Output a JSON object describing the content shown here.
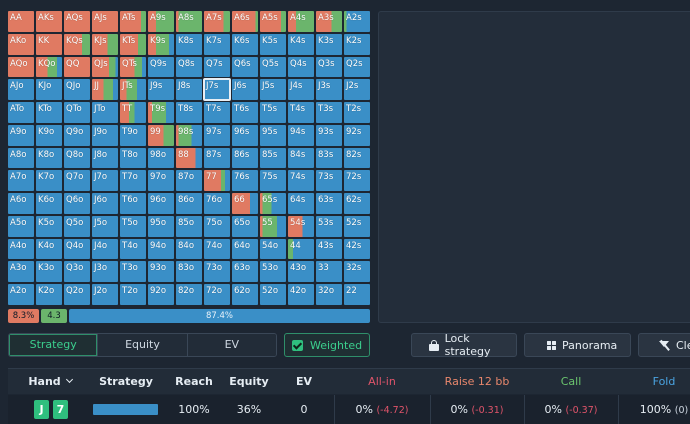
{
  "grid": {
    "ranks": [
      "A",
      "K",
      "Q",
      "J",
      "T",
      "9",
      "8",
      "7",
      "6",
      "5",
      "4",
      "3",
      "2"
    ],
    "selected": "J7s",
    "colors": {
      "raise": "#e07a62",
      "call": "#6bb56c",
      "fold": "#3a8fc7"
    },
    "cells": {
      "AA": [
        1,
        0,
        0
      ],
      "AKs": [
        1,
        0,
        0
      ],
      "AQs": [
        1,
        0,
        0
      ],
      "AJs": [
        1,
        0,
        0
      ],
      "ATs": [
        0.8,
        0.2,
        0
      ],
      "A9s": [
        0.3,
        0.7,
        0
      ],
      "A8s": [
        0.1,
        0.9,
        0
      ],
      "A7s": [
        0.75,
        0.25,
        0
      ],
      "A6s": [
        0.9,
        0.1,
        0
      ],
      "A5s": [
        0.8,
        0.2,
        0
      ],
      "A4s": [
        0.3,
        0.7,
        0
      ],
      "A3s": [
        0.6,
        0.4,
        0
      ],
      "A2s": [
        0,
        0.1,
        0.9
      ],
      "AKo": [
        1,
        0,
        0
      ],
      "KK": [
        1,
        0,
        0
      ],
      "KQs": [
        0.7,
        0.3,
        0
      ],
      "KJs": [
        0.6,
        0.4,
        0
      ],
      "KTs": [
        0.7,
        0.3,
        0
      ],
      "K9s": [
        0.3,
        0.5,
        0.2
      ],
      "K8s": [
        0,
        0,
        1
      ],
      "K7s": [
        0,
        0,
        1
      ],
      "K6s": [
        0,
        0,
        1
      ],
      "K5s": [
        0,
        0,
        1
      ],
      "K4s": [
        0,
        0,
        1
      ],
      "K3s": [
        0,
        0,
        1
      ],
      "K2s": [
        0,
        0,
        1
      ],
      "AQo": [
        1,
        0,
        0
      ],
      "KQo": [
        0.45,
        0.35,
        0.2
      ],
      "QQ": [
        1,
        0,
        0
      ],
      "QJs": [
        0.65,
        0.25,
        0.1
      ],
      "QTs": [
        0.55,
        0.3,
        0.15
      ],
      "JJ": [
        0.45,
        0.35,
        0.2
      ],
      "JTs": [
        0.25,
        0.4,
        0.35
      ],
      "TT": [
        0.35,
        0.2,
        0.45
      ],
      "T9s": [
        0.15,
        0.55,
        0.3
      ],
      "98s": [
        0.1,
        0.5,
        0.4
      ],
      "99": [
        0.6,
        0.4,
        0
      ],
      "88": [
        0.75,
        0,
        0.25
      ],
      "77": [
        0.65,
        0.15,
        0.2
      ],
      "66": [
        0.7,
        0,
        0.3
      ],
      "65s": [
        0.1,
        0.35,
        0.55
      ],
      "55": [
        0.1,
        0.55,
        0.35
      ],
      "54s": [
        0.55,
        0,
        0.45
      ],
      "44": [
        0,
        0.2,
        0.8
      ],
      "33": [
        0,
        0,
        1
      ],
      "22": [
        0,
        0,
        1
      ]
    }
  },
  "freq": {
    "raise": "8.3%",
    "call": "4.3",
    "fold": "87.4%"
  },
  "tabs": [
    "Strategy",
    "Equity",
    "EV"
  ],
  "active_tab": "Strategy",
  "weighted_label": "Weighted",
  "buttons": {
    "lock": "Lock strategy",
    "panorama": "Panorama",
    "clear": "Cle"
  },
  "table": {
    "headers": {
      "hand": "Hand",
      "strategy": "Strategy",
      "reach": "Reach",
      "equity": "Equity",
      "ev": "EV",
      "allin": "All-in",
      "raise": "Raise 12 bb",
      "call": "Call",
      "fold": "Fold"
    },
    "row": {
      "cards": [
        "J",
        "7"
      ],
      "reach": "100%",
      "equity": "36%",
      "ev": "0",
      "allin": {
        "pct": "0%",
        "ev": "(-4.72)"
      },
      "raise": {
        "pct": "0%",
        "ev": "(-0.31)"
      },
      "call": {
        "pct": "0%",
        "ev": "(-0.37)"
      },
      "fold": {
        "pct": "100%",
        "ev": "(0)"
      }
    }
  }
}
